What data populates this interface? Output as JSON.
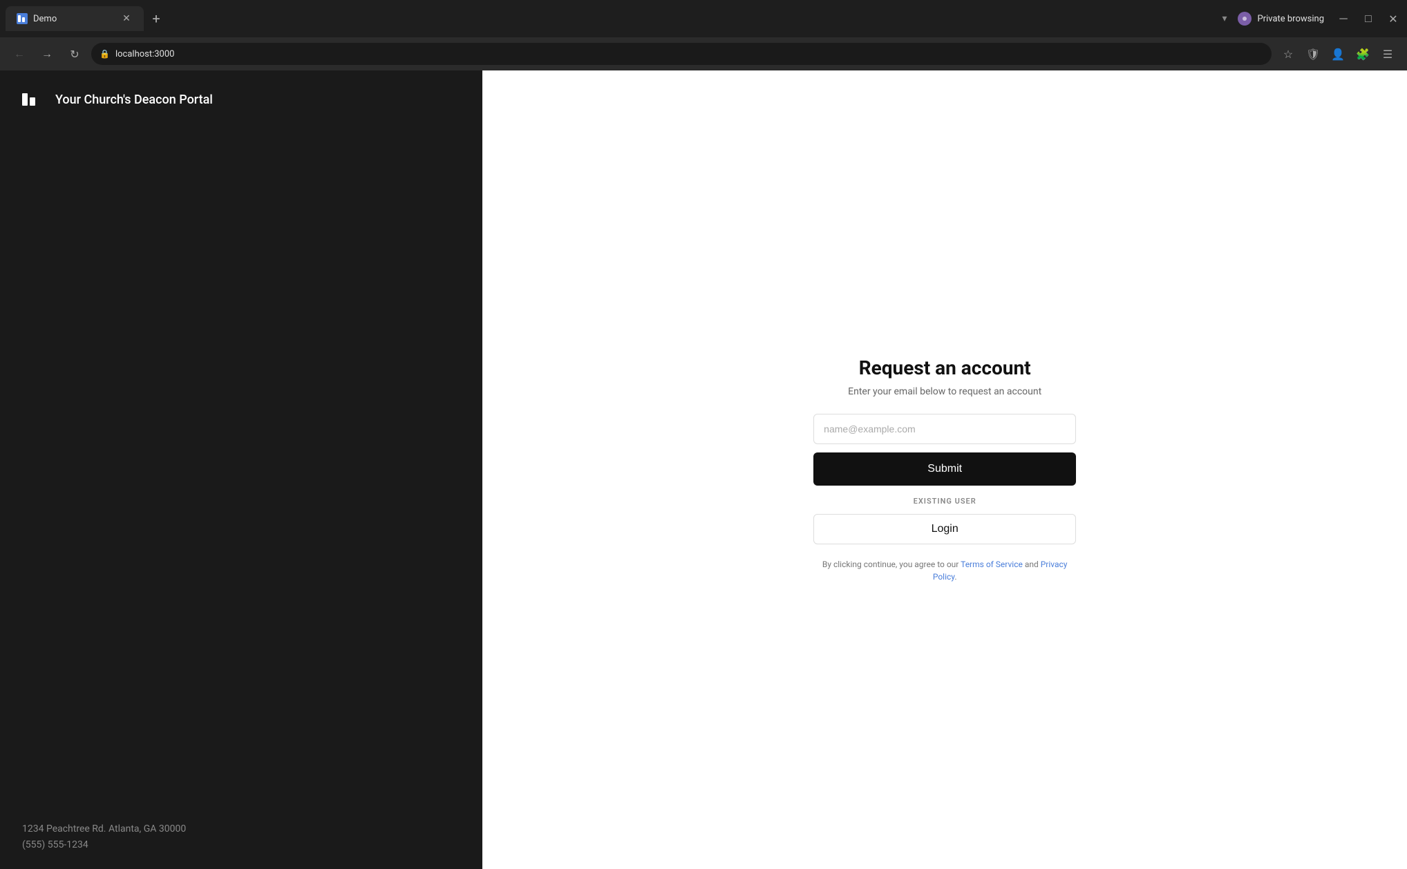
{
  "browser": {
    "tab": {
      "title": "Demo",
      "favicon_label": "D"
    },
    "new_tab_label": "+",
    "address_bar": {
      "url": "localhost:3000"
    },
    "private_browsing": {
      "label": "Private browsing",
      "icon_label": "P"
    },
    "window_controls": {
      "minimize": "─",
      "maximize": "□",
      "close": "✕"
    },
    "nav": {
      "back": "←",
      "forward": "→",
      "refresh": "↻",
      "chevron_down": "▾"
    }
  },
  "left_panel": {
    "portal_title": "Your Church's Deacon Portal",
    "address_line1": "1234 Peachtree Rd. Atlanta, GA 30000",
    "address_line2": "(555) 555-1234"
  },
  "right_panel": {
    "form_title": "Request an account",
    "form_subtitle": "Enter your email below to request an account",
    "email_placeholder": "name@example.com",
    "submit_label": "Submit",
    "existing_user_label": "EXISTING USER",
    "login_label": "Login",
    "terms_prefix": "By clicking continue, you agree to our ",
    "terms_link1": "Terms of Service",
    "terms_and": " and ",
    "terms_link2": "Privacy Policy",
    "terms_suffix": "."
  }
}
